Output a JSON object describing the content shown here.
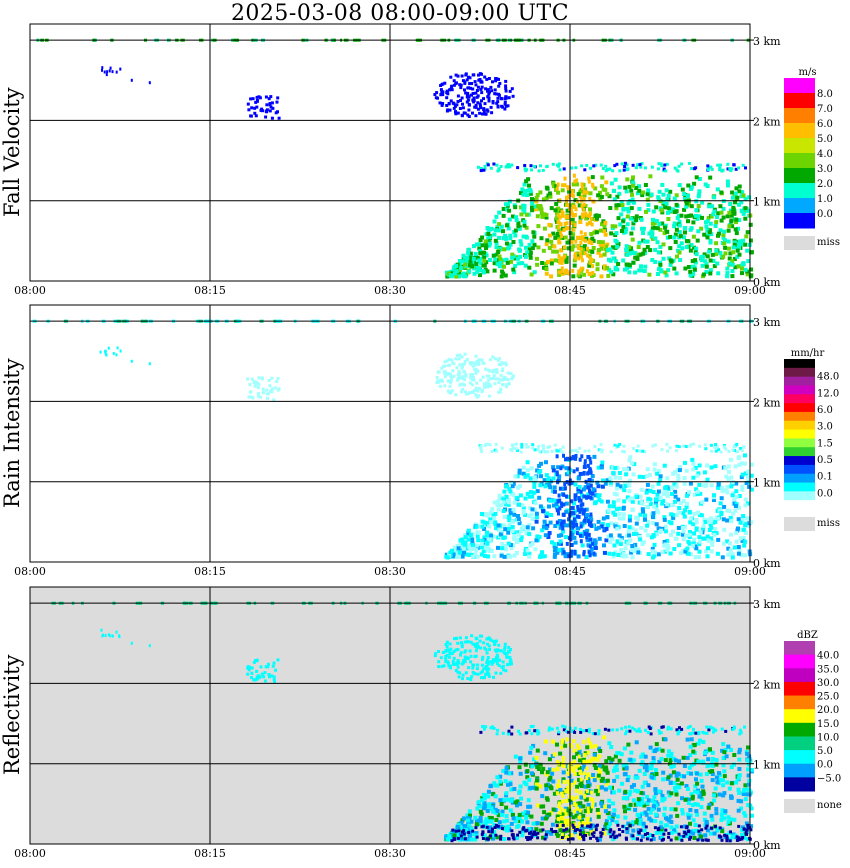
{
  "title": "2025-03-08   08:00-09:00 UTC",
  "chart_data": [
    {
      "type": "heatmap",
      "title": "2025-03-08   08:00-09:00 UTC",
      "ylabel": "Fall Velocity",
      "xlabel": "",
      "x_ticks": [
        "08:00",
        "08:15",
        "08:30",
        "08:45",
        "09:00"
      ],
      "y_ticks": [
        "0 km",
        "1 km",
        "2 km",
        "3 km"
      ],
      "ylim_km": [
        0,
        3
      ],
      "grid": true,
      "legend_unit": "m/s",
      "legend_levels": [
        "8.0",
        "7.0",
        "6.0",
        "5.0",
        "4.0",
        "3.0",
        "2.0",
        "1.0",
        "0.0"
      ],
      "legend_colors": [
        "#ff00ff",
        "#ff0000",
        "#ff7f00",
        "#ffbf00",
        "#c8e600",
        "#6cd400",
        "#00a800",
        "#00ffd0",
        "#00a8ff",
        "#0000ff"
      ],
      "missing_label": "miss",
      "missing_color": "#dcdcdc",
      "background": "#ffffff"
    },
    {
      "type": "heatmap",
      "ylabel": "Rain Intensity",
      "xlabel": "",
      "x_ticks": [
        "08:00",
        "08:15",
        "08:30",
        "08:45",
        "09:00"
      ],
      "y_ticks": [
        "0 km",
        "1 km",
        "2 km",
        "3 km"
      ],
      "ylim_km": [
        0,
        3
      ],
      "grid": true,
      "legend_unit": "mm/hr",
      "legend_levels": [
        "48.0",
        "12.0",
        "6.0",
        "3.0",
        "1.5",
        "0.5",
        "0.1",
        "0.0"
      ],
      "legend_colors": [
        "#000000",
        "#6e1a46",
        "#a020a0",
        "#d000c0",
        "#ff0060",
        "#ff0000",
        "#ff8000",
        "#ffd000",
        "#ffff00",
        "#90ff40",
        "#30d030",
        "#0000d0",
        "#0050ff",
        "#00a0ff",
        "#00ffff",
        "#a0ffff",
        "#ffffff"
      ],
      "missing_label": "miss",
      "missing_color": "#dcdcdc",
      "background": "#ffffff"
    },
    {
      "type": "heatmap",
      "ylabel": "Reflectivity",
      "xlabel": "",
      "x_ticks": [
        "08:00",
        "08:15",
        "08:30",
        "08:45",
        "09:00"
      ],
      "y_ticks": [
        "0 km",
        "1 km",
        "2 km",
        "3 km"
      ],
      "ylim_km": [
        0,
        3
      ],
      "grid": true,
      "legend_unit": "dBZ",
      "legend_levels": [
        "40.0",
        "35.0",
        "30.0",
        "25.0",
        "20.0",
        "15.0",
        "10.0",
        "5.0",
        "0.0",
        "−5.0"
      ],
      "legend_colors": [
        "#b040b0",
        "#ff00ff",
        "#c000c0",
        "#ff0000",
        "#ff7f00",
        "#ffff00",
        "#00a800",
        "#00d080",
        "#00ffff",
        "#00a0ff",
        "#0000a0"
      ],
      "missing_label": "none",
      "missing_color": "#dcdcdc",
      "background": "#dcdcdc"
    }
  ]
}
